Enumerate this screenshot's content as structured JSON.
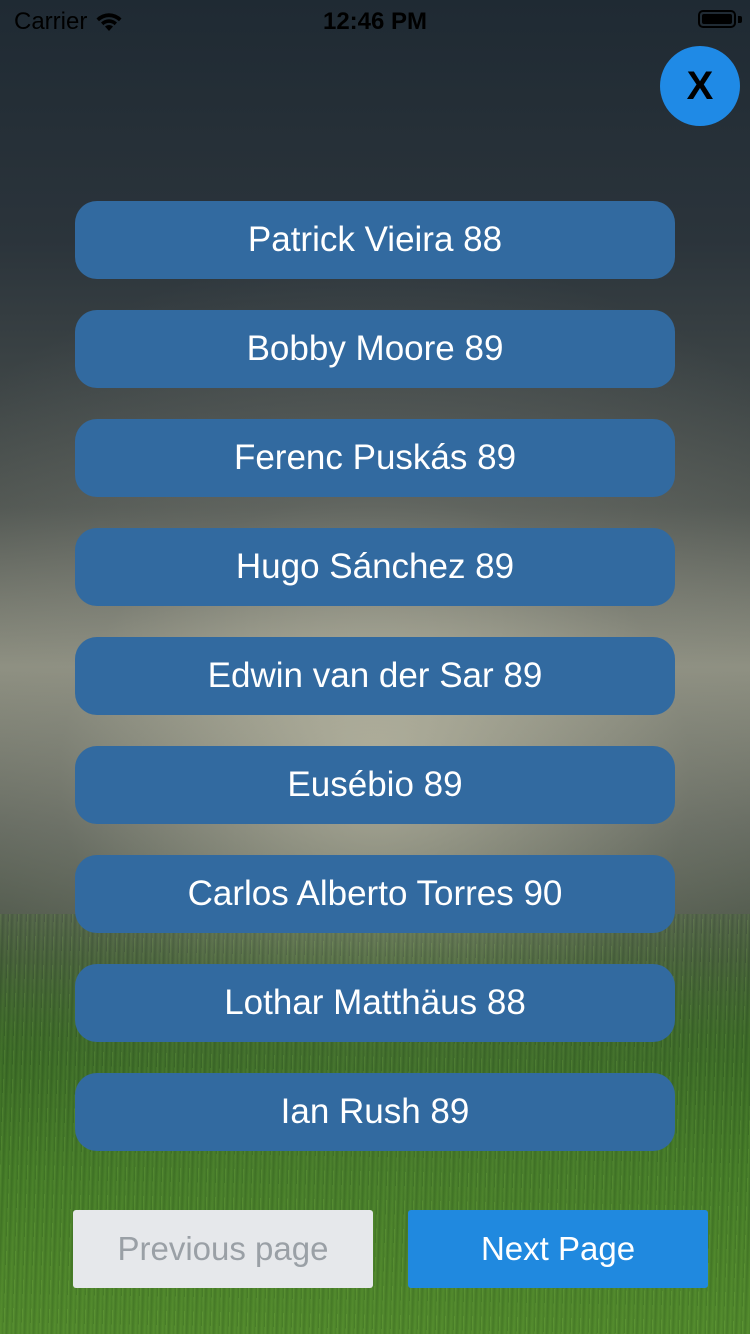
{
  "status_bar": {
    "carrier": "Carrier",
    "time": "12:46 PM",
    "wifi_icon": "wifi-icon",
    "battery_icon": "battery-icon"
  },
  "close_button": {
    "label": "X",
    "color": "#1f8ae6"
  },
  "players": [
    {
      "label": "Patrick Vieira 88"
    },
    {
      "label": "Bobby Moore 89"
    },
    {
      "label": "Ferenc Puskás 89"
    },
    {
      "label": "Hugo Sánchez 89"
    },
    {
      "label": "Edwin van der Sar 89"
    },
    {
      "label": "Eusébio 89"
    },
    {
      "label": "Carlos Alberto Torres 90"
    },
    {
      "label": "Lothar Matthäus 88"
    },
    {
      "label": "Ian Rush 89"
    }
  ],
  "pagination": {
    "previous_label": "Previous page",
    "next_label": "Next Page",
    "previous_enabled": false,
    "next_color": "#2089df"
  },
  "colors": {
    "player_button": "#326aa0"
  }
}
